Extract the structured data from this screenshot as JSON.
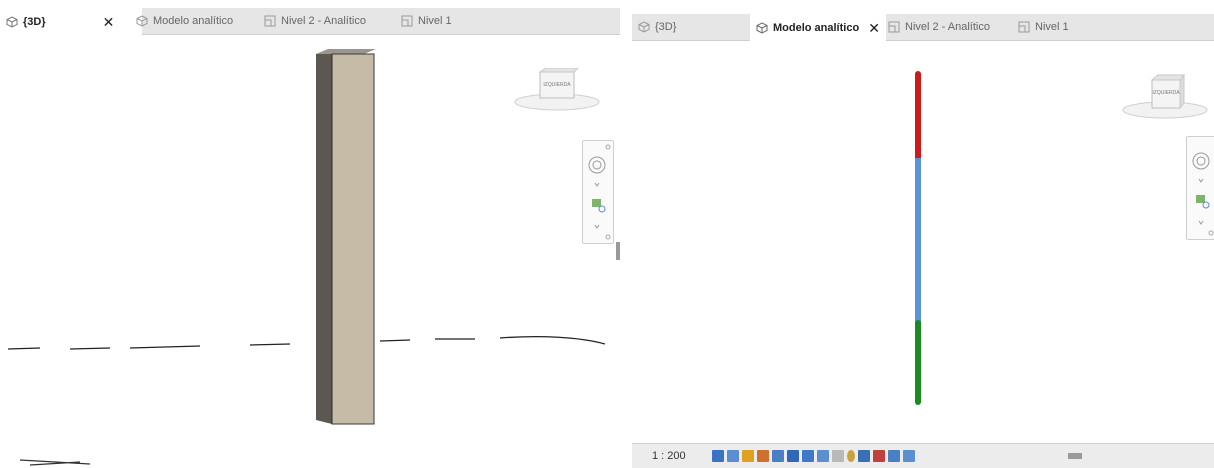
{
  "left_view": {
    "tabs": [
      {
        "label": "{3D}",
        "active": true,
        "icon": "3d-box-icon"
      },
      {
        "label": "Modelo analítico",
        "active": false,
        "icon": "3d-box-icon"
      },
      {
        "label": "Nivel 2 - Analítico",
        "active": false,
        "icon": "floor-plan-icon"
      },
      {
        "label": "Nivel 1",
        "active": false,
        "icon": "floor-plan-icon"
      }
    ],
    "viewcube_face": "IZQUIERDA"
  },
  "right_view": {
    "tabs": [
      {
        "label": "{3D}",
        "active": false,
        "icon": "3d-box-icon"
      },
      {
        "label": "Modelo analítico",
        "active": true,
        "icon": "3d-box-icon"
      },
      {
        "label": "Nivel 2 - Analítico",
        "active": false,
        "icon": "floor-plan-icon"
      },
      {
        "label": "Nivel 1",
        "active": false,
        "icon": "floor-plan-icon"
      }
    ],
    "viewcube_face": "IZQUIERDA",
    "analytical_member_colors": [
      "#cc1b1b",
      "#5b93d6",
      "#1b8a22"
    ],
    "status": {
      "scale": "1 : 200"
    }
  }
}
